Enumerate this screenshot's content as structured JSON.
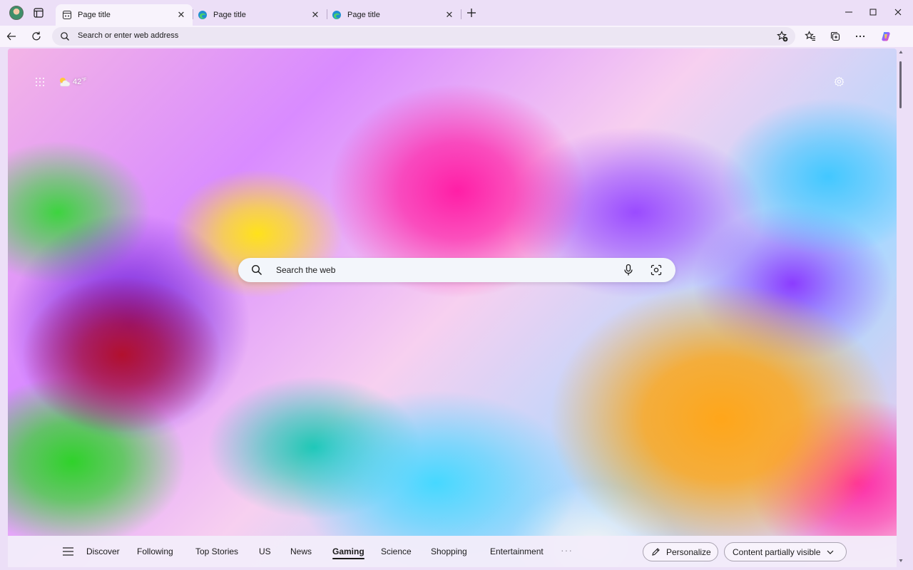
{
  "tabs": [
    {
      "title": "Page title",
      "active": true,
      "favicon": "new-tab-icon"
    },
    {
      "title": "Page title",
      "active": false,
      "favicon": "edge-icon"
    },
    {
      "title": "Page title",
      "active": false,
      "favicon": "edge-icon"
    }
  ],
  "tab_close_glyph": "✕",
  "address_bar": {
    "placeholder": "Search or enter web address"
  },
  "weather": {
    "temperature": "42",
    "unit": "°F",
    "icon": "partly-cloudy-icon"
  },
  "search": {
    "placeholder": "Search the web"
  },
  "feed_nav": {
    "items": [
      "Discover",
      "Following",
      "Top Stories",
      "US",
      "News",
      "Gaming",
      "Science",
      "Shopping",
      "Entertainment"
    ],
    "active": "Gaming",
    "more": "···"
  },
  "buttons": {
    "personalize": "Personalize",
    "content_visibility": "Content partially visible"
  },
  "colors": {
    "frame": "#ecdff7",
    "toolbar": "#f8f3fc",
    "addressbar": "#ece6f3",
    "search_box": "#f3f6fb"
  }
}
